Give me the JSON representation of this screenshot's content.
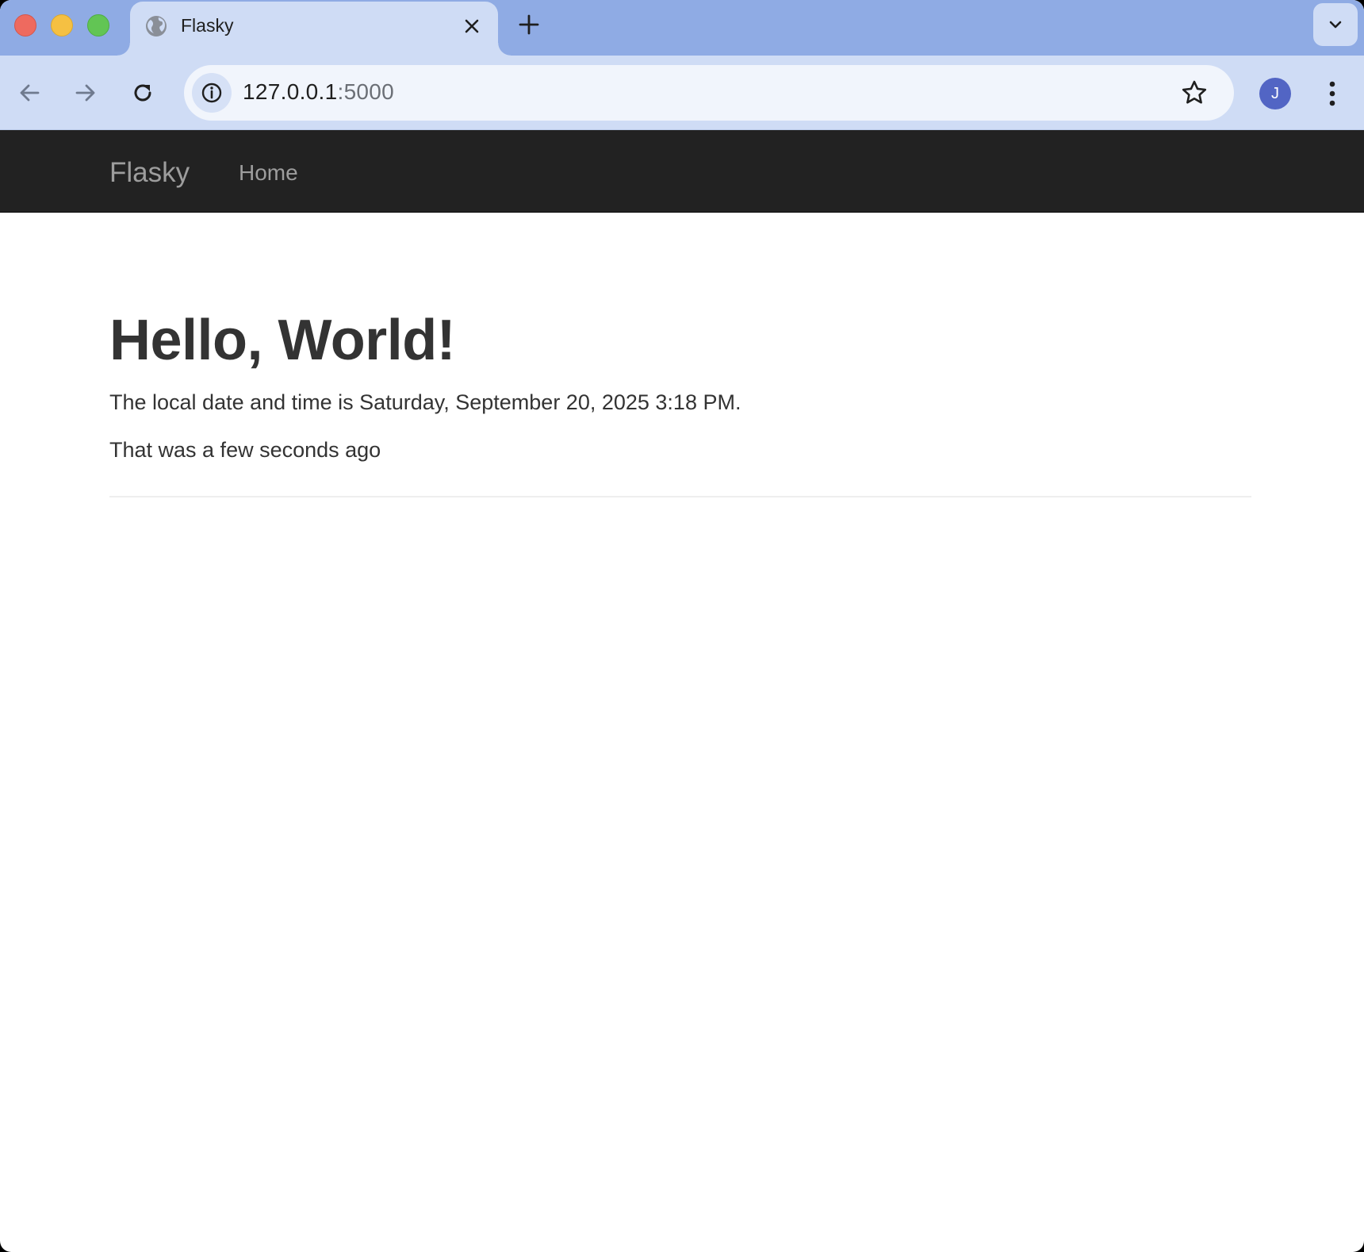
{
  "browser": {
    "tab_title": "Flasky",
    "url_host": "127.0.0.1",
    "url_port": ":5000",
    "profile_initial": "J"
  },
  "icons": {
    "favicon": "globe-icon",
    "tab_close": "close-icon",
    "new_tab": "plus-icon",
    "tab_search": "chevron-down-icon",
    "back": "arrow-left-icon",
    "forward": "arrow-right-icon",
    "reload": "reload-icon",
    "site_info": "info-icon",
    "bookmark": "star-icon",
    "menu": "kebab-icon"
  },
  "navbar": {
    "brand": "Flasky",
    "items": [
      {
        "label": "Home"
      }
    ]
  },
  "page": {
    "heading": "Hello, World!",
    "datetime_text": "The local date and time is Saturday, September 20, 2025 3:18 PM.",
    "relative_text": "That was a few seconds ago"
  },
  "colors": {
    "tabstrip": "#8fabe4",
    "toolbar": "#cfdcf5",
    "navbar": "#222222",
    "nav_text": "#9d9d9d",
    "body_text": "#333333",
    "avatar": "#5265c4"
  }
}
